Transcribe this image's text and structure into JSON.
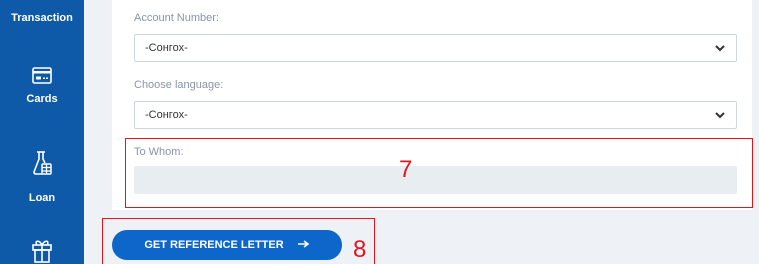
{
  "sidebar": {
    "items": [
      {
        "label": "Transaction",
        "icon": "transaction-icon"
      },
      {
        "label": "Cards",
        "icon": "card-icon"
      },
      {
        "label": "Loan",
        "icon": "loan-flask-icon"
      },
      {
        "label": "",
        "icon": "gift-icon"
      }
    ]
  },
  "form": {
    "account_number": {
      "label": "Account Number:",
      "value": "-Сонгох-"
    },
    "language": {
      "label": "Choose language:",
      "value": "-Сонгох-"
    },
    "to_whom": {
      "label": "To Whom:",
      "value": ""
    }
  },
  "actions": {
    "submit_label": "GET REFERENCE LETTER"
  },
  "annotations": {
    "to_whom_marker": "7",
    "button_marker": "8"
  },
  "colors": {
    "sidebar": "#0f5aa8",
    "primary": "#0d66c9",
    "annotation": "#e0161c",
    "page_bg": "#eef1f6"
  }
}
